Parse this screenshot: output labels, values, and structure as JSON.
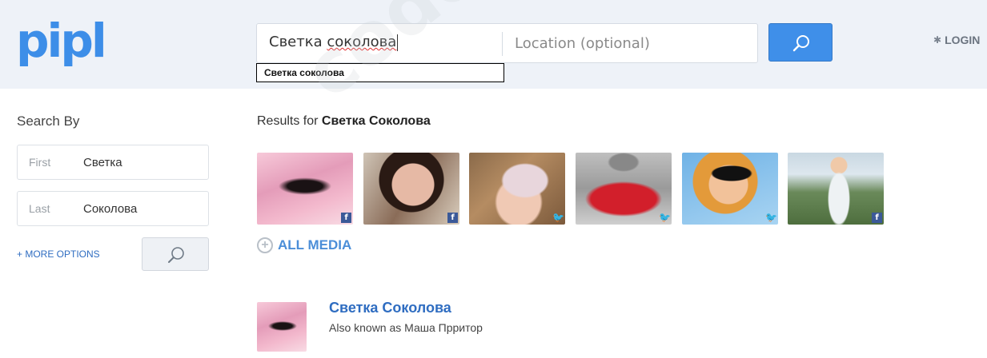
{
  "header": {
    "logo": "pipl",
    "search": {
      "name_value": "Светка соколова",
      "name_first_word": "Светка",
      "name_second_word": "соколова",
      "location_placeholder": "Location (optional)"
    },
    "autocomplete": [
      "Светка соколова"
    ],
    "login_label": "LOGIN"
  },
  "sidebar": {
    "title": "Search By",
    "first_label": "First",
    "first_value": "Светка",
    "last_label": "Last",
    "last_value": "Соколова",
    "more_options": "+ MORE OPTIONS"
  },
  "results": {
    "prefix": "Results for",
    "query": "Светка Соколова",
    "media": [
      {
        "source": "facebook-icon"
      },
      {
        "source": "facebook-icon"
      },
      {
        "source": "twitter-icon"
      },
      {
        "source": "twitter-icon"
      },
      {
        "source": "twitter-icon"
      },
      {
        "source": "facebook-icon"
      }
    ],
    "all_media_label": "ALL MEDIA",
    "person": {
      "name": "Светка Соколова",
      "aka": "Also known as Маша Прритор"
    }
  },
  "watermark": "codeby.net",
  "colors": {
    "accent": "#3f8fe9",
    "link": "#2f6dc1",
    "header_bg": "#eef2f8",
    "facebook": "#3b5998",
    "twitter": "#1da1f2"
  }
}
